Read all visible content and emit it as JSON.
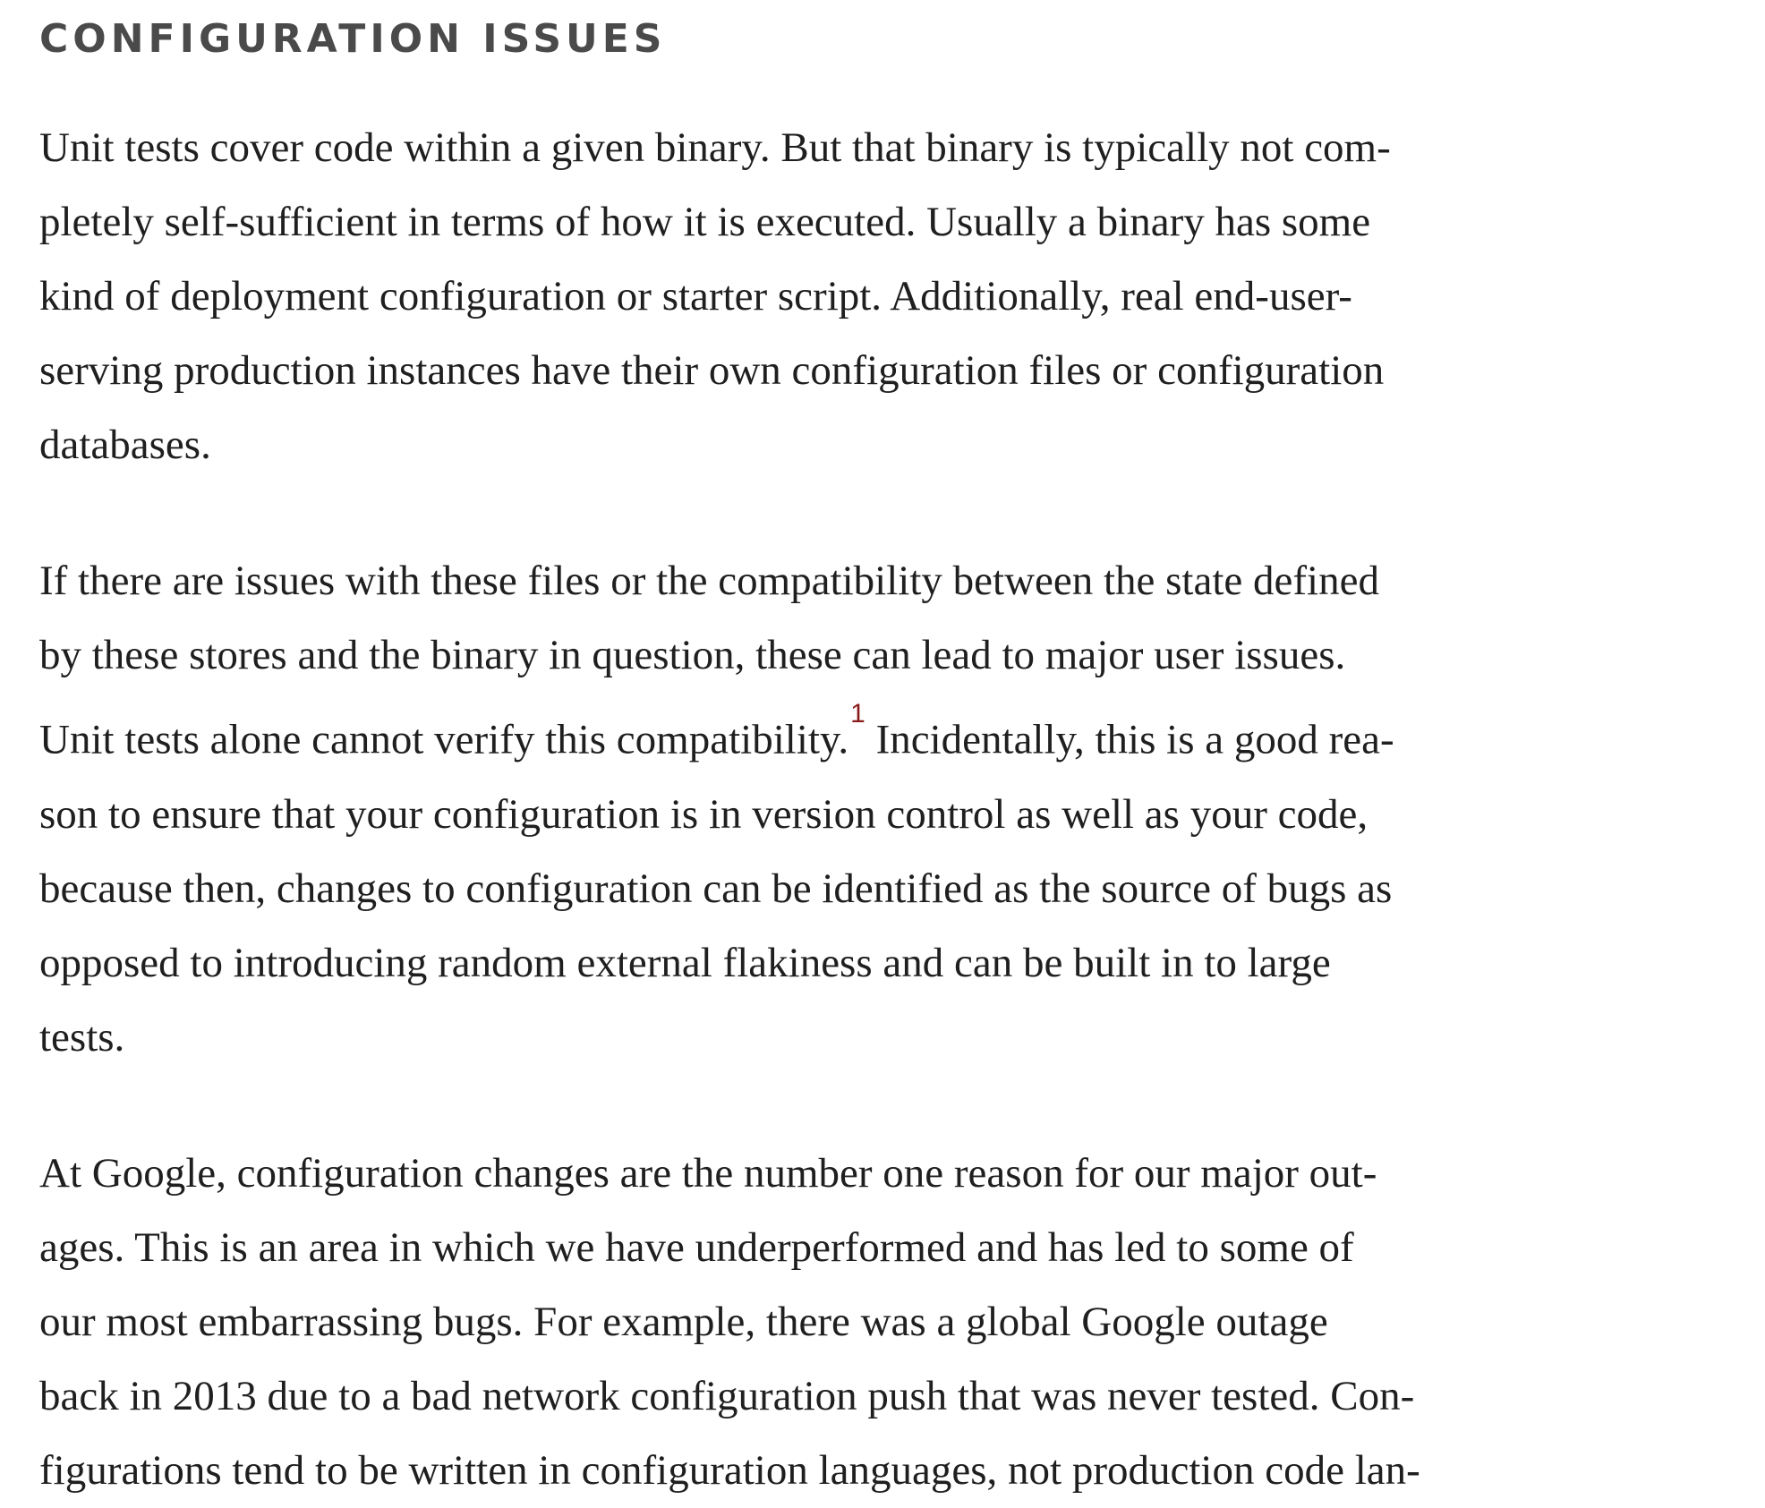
{
  "section": {
    "heading": "CONFIGURATION ISSUES"
  },
  "paragraphs": {
    "p1": {
      "lines": [
        "Unit tests cover code within a given binary. But that binary is typically not com-",
        "pletely self-sufficient in terms of how it is executed. Usually a binary has some",
        "kind of deployment configuration or starter script. Additionally, real end-user-",
        "serving production instances have their own configuration files or configuration",
        "databases."
      ]
    },
    "p2": {
      "lines": [
        "If there are issues with these files or the compatibility between the state defined",
        "by these stores and the binary in question, these can lead to major user issues."
      ],
      "line3_before": "Unit tests alone cannot verify this compatibility.",
      "footnote": "1",
      "line3_after": " Incidentally, this is a good rea-",
      "lines_rest": [
        "son to ensure that your configuration is in version control as well as your code,",
        "because then, changes to configuration can be identified as the source of bugs as",
        "opposed to introducing random external flakiness and can be built in to large",
        "tests."
      ]
    },
    "p3": {
      "lines": [
        "At Google, configuration changes are the number one reason for our major out-",
        "ages. This is an area in which we have underperformed and has led to some of",
        "our most embarrassing bugs. For example, there was a global Google outage",
        "back in 2013 due to a bad network configuration push that was never tested. Con-",
        "figurations tend to be written in configuration languages, not production code lan-"
      ]
    }
  }
}
